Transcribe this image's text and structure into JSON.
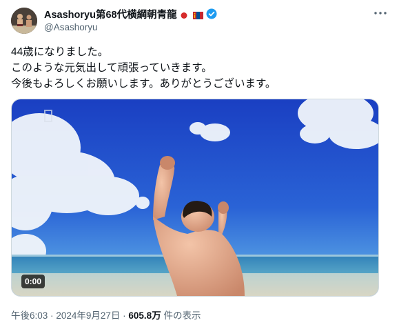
{
  "author": {
    "display_name": "Asashoryu第68代横綱朝青龍",
    "handle": "@Asashoryu"
  },
  "tweet": {
    "lines": [
      "44歳になりました。",
      "このような元気出して頑張っていきます。",
      "今後もよろしくお願いします。ありがとうございます。"
    ]
  },
  "media": {
    "video_time": "0:00"
  },
  "meta": {
    "time": "午後6:03",
    "separator": "·",
    "date": "2024年9月27日",
    "views_count": "605.8万",
    "views_label": "件の表示"
  },
  "colors": {
    "verified": "#1d9bf0",
    "secondary_text": "#536471",
    "sky_top": "#1746c9",
    "sea": "#2f8fc0"
  }
}
